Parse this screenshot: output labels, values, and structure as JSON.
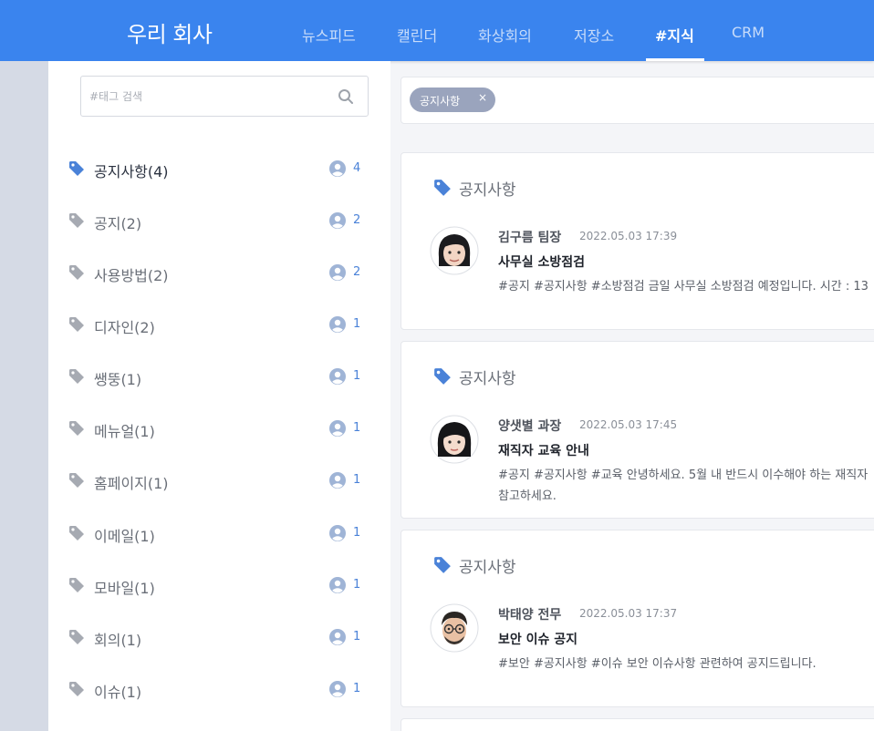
{
  "header": {
    "brand": "우리 회사",
    "nav": [
      "뉴스피드",
      "캘린더",
      "화상회의",
      "저장소",
      "#지식",
      "CRM"
    ],
    "active_nav": "#지식",
    "accent_color": "#3a84ee"
  },
  "sidebar": {
    "search_placeholder": "#태그 검색",
    "tags": [
      {
        "label": "공지사항(4)",
        "count": "4",
        "active": true
      },
      {
        "label": "공지(2)",
        "count": "2"
      },
      {
        "label": "사용방법(2)",
        "count": "2"
      },
      {
        "label": "디자인(2)",
        "count": "1"
      },
      {
        "label": "쌩뚱(1)",
        "count": "1"
      },
      {
        "label": "메뉴얼(1)",
        "count": "1"
      },
      {
        "label": "홈페이지(1)",
        "count": "1"
      },
      {
        "label": "이메일(1)",
        "count": "1"
      },
      {
        "label": "모바일(1)",
        "count": "1"
      },
      {
        "label": "회의(1)",
        "count": "1"
      },
      {
        "label": "이슈(1)",
        "count": "1"
      }
    ]
  },
  "filter": {
    "chips": [
      {
        "label": "공지사항",
        "close": "×"
      }
    ]
  },
  "posts": [
    {
      "tag": "공지사항",
      "author": "김구름 팀장",
      "time": "2022.05.03 17:39",
      "title": "사무실 소방점검",
      "body": [
        "#공지 #공지사항 #소방점검 금일 사무실 소방점검 예정입니다. 시간 : 13"
      ]
    },
    {
      "tag": "공지사항",
      "author": "양샛별 과장",
      "time": "2022.05.03 17:45",
      "title": "재직자 교육 안내",
      "body": [
        "#공지 #공지사항 #교육 안녕하세요. 5월 내 반드시 이수해야 하는 재직자",
        "참고하세요."
      ]
    },
    {
      "tag": "공지사항",
      "author": "박태양 전무",
      "time": "2022.05.03 17:37",
      "title": "보안 이슈 공지",
      "body": [
        "#보안 #공지사항 #이슈 보안 이슈사항 관련하여 공지드립니다."
      ]
    }
  ]
}
